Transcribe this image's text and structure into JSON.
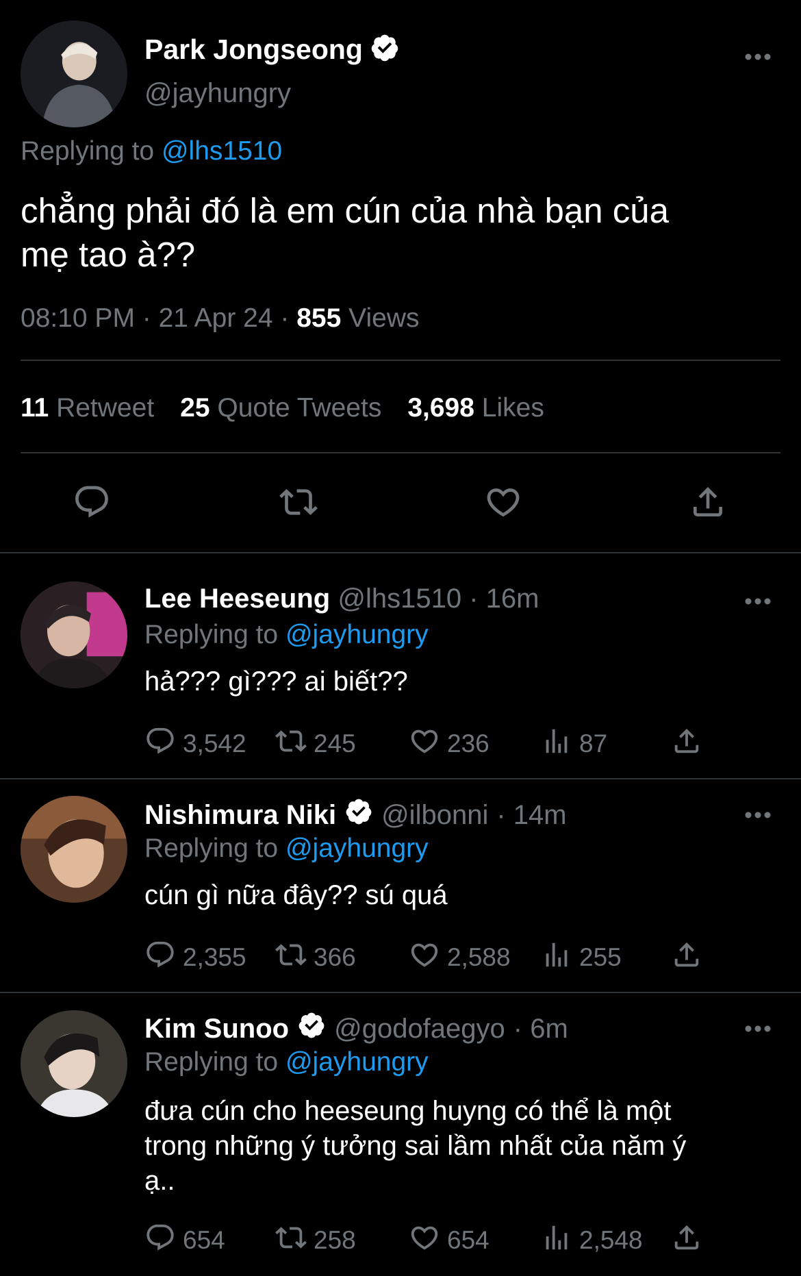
{
  "main_tweet": {
    "display_name": "Park Jongseong",
    "handle": "@jayhungry",
    "replying_prefix": "Replying to",
    "replying_handle": "@lhs1510",
    "text_line1": "chẳng phải đó là em cún của nhà bạn của",
    "text_line2": "mẹ tao à??",
    "time": "08:10 PM · 21 Apr 24 ·",
    "views_count": "855",
    "views_label": "Views",
    "retweet_count": "11",
    "retweet_label": "Retweet",
    "quote_count": "25",
    "quote_label": "Quote Tweets",
    "likes_count": "3,698",
    "likes_label": "Likes"
  },
  "replies": [
    {
      "display_name": "Lee Heeseung",
      "handle": "@lhs1510",
      "time": "· 16m",
      "verified": false,
      "replying_prefix": "Replying to",
      "replying_handle": "@jayhungry",
      "text_lines": [
        "hả??? gì??? ai biết??"
      ],
      "replies": "3,542",
      "retweets": "245",
      "likes": "236",
      "views": "87"
    },
    {
      "display_name": "Nishimura Niki",
      "handle": "@ilbonni",
      "time": "· 14m",
      "verified": true,
      "replying_prefix": "Replying to",
      "replying_handle": "@jayhungry",
      "text_lines": [
        "cún gì nữa đây?? sú quá"
      ],
      "replies": "2,355",
      "retweets": "366",
      "likes": "2,588",
      "views": "255"
    },
    {
      "display_name": "Kim Sunoo",
      "handle": "@godofaegyo",
      "time": "· 6m",
      "verified": true,
      "replying_prefix": "Replying to",
      "replying_handle": "@jayhungry",
      "text_lines": [
        "đưa cún cho heeseung huyng có thể là một",
        "trong những ý tưởng sai lầm nhất của năm ý",
        "ạ.."
      ],
      "replies": "654",
      "retweets": "258",
      "likes": "654",
      "views": "2,548"
    }
  ],
  "icons": {
    "more": "more-horizontal-icon",
    "verified": "verified-badge-icon",
    "reply": "reply-bubble-icon",
    "retweet": "retweet-icon",
    "like": "heart-icon",
    "views": "views-chart-icon",
    "share": "share-icon"
  },
  "colors": {
    "background": "#000000",
    "text": "#e7e9ea",
    "secondary": "#71767b",
    "link": "#1d9bf0",
    "divider": "#2f3336"
  }
}
